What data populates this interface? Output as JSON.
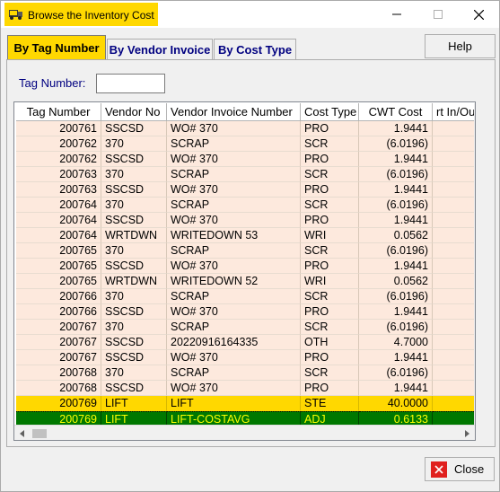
{
  "window": {
    "title": "Browse the Inventory Cost",
    "icon": "truck-icon",
    "controls": {
      "minimize": "minimize-icon",
      "maximize": "maximize-icon",
      "close": "close-icon"
    }
  },
  "tabs": [
    {
      "label": "By Tag Number",
      "active": true
    },
    {
      "label": "By Vendor Invoice",
      "active": false
    },
    {
      "label": "By Cost Type",
      "active": false
    }
  ],
  "help_label": "Help",
  "search": {
    "label": "Tag Number:",
    "value": ""
  },
  "grid": {
    "columns": [
      "Tag Number",
      "Vendor No",
      "Vendor Invoice Number",
      "Cost Type",
      "CWT Cost",
      "rt In/Ou"
    ],
    "rows": [
      [
        "200761",
        "SSCSD",
        "WO# 370",
        "PRO",
        "1.9441",
        ""
      ],
      [
        "200762",
        "370",
        "SCRAP",
        "SCR",
        "(6.0196)",
        ""
      ],
      [
        "200762",
        "SSCSD",
        "WO# 370",
        "PRO",
        "1.9441",
        ""
      ],
      [
        "200763",
        "370",
        "SCRAP",
        "SCR",
        "(6.0196)",
        ""
      ],
      [
        "200763",
        "SSCSD",
        "WO# 370",
        "PRO",
        "1.9441",
        ""
      ],
      [
        "200764",
        "370",
        "SCRAP",
        "SCR",
        "(6.0196)",
        ""
      ],
      [
        "200764",
        "SSCSD",
        "WO# 370",
        "PRO",
        "1.9441",
        ""
      ],
      [
        "200764",
        "WRTDWN",
        "WRITEDOWN 53",
        "WRI",
        "0.0562",
        ""
      ],
      [
        "200765",
        "370",
        "SCRAP",
        "SCR",
        "(6.0196)",
        ""
      ],
      [
        "200765",
        "SSCSD",
        "WO# 370",
        "PRO",
        "1.9441",
        ""
      ],
      [
        "200765",
        "WRTDWN",
        "WRITEDOWN 52",
        "WRI",
        "0.0562",
        ""
      ],
      [
        "200766",
        "370",
        "SCRAP",
        "SCR",
        "(6.0196)",
        ""
      ],
      [
        "200766",
        "SSCSD",
        "WO# 370",
        "PRO",
        "1.9441",
        ""
      ],
      [
        "200767",
        "370",
        "SCRAP",
        "SCR",
        "(6.0196)",
        ""
      ],
      [
        "200767",
        "SSCSD",
        "20220916164335",
        "OTH",
        "4.7000",
        ""
      ],
      [
        "200767",
        "SSCSD",
        "WO# 370",
        "PRO",
        "1.9441",
        ""
      ],
      [
        "200768",
        "370",
        "SCRAP",
        "SCR",
        "(6.0196)",
        ""
      ],
      [
        "200768",
        "SSCSD",
        "WO# 370",
        "PRO",
        "1.9441",
        ""
      ],
      [
        "200769",
        "LIFT",
        "LIFT",
        "STE",
        "40.0000",
        ""
      ],
      [
        "200769",
        "LIFT",
        "LIFT-COSTAVG",
        "ADJ",
        "0.6133",
        ""
      ]
    ],
    "highlight_rows": {
      "yellow": 18,
      "green": 19
    },
    "colors": {
      "row_bg": "#fde9dd",
      "yellow": "#ffd800",
      "green": "#007800",
      "green_text": "#ffff00"
    }
  },
  "close_label": "Close"
}
